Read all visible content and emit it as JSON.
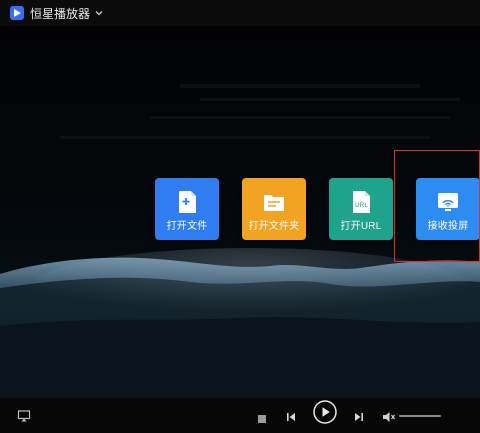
{
  "app": {
    "title": "恒星播放器",
    "icons": [
      "app-logo-icon",
      "chevron-down-icon"
    ]
  },
  "tiles": [
    {
      "label": "打开文件",
      "color": "#2f7df0",
      "icon": "file-add-icon"
    },
    {
      "label": "打开文件夹",
      "color": "#f2a321",
      "icon": "folder-icon"
    },
    {
      "label": "打开URL",
      "color": "#1fa38c",
      "icon": "url-file-icon"
    },
    {
      "label": "接收投屏",
      "color": "#2d8cf2",
      "icon": "cast-screen-icon"
    }
  ],
  "highlight": {
    "color": "#e12a2a",
    "target": "接收投屏"
  },
  "controls": {
    "icons": [
      "screen-cast-small-icon",
      "stop-icon",
      "previous-icon",
      "play-icon",
      "next-icon",
      "volume-icon"
    ],
    "volume_level": 0
  }
}
